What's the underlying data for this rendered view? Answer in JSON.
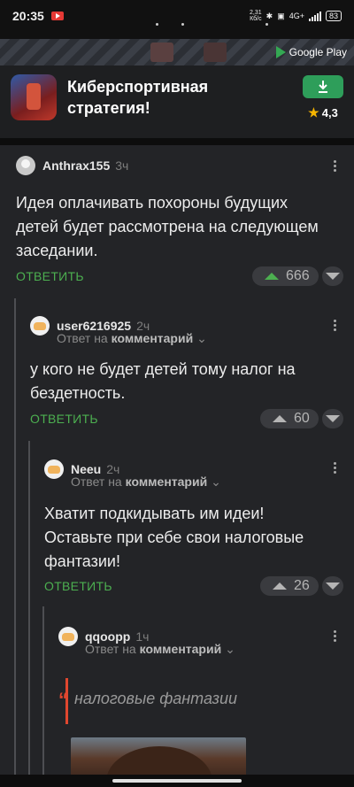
{
  "status_bar": {
    "time": "20:35",
    "speed_value": "2,31",
    "speed_unit": "Кб/с",
    "network": "4G+",
    "battery": "83"
  },
  "ad": {
    "store_label": "Google Play",
    "title": "Киберспортивная стратегия!",
    "rating": "4,3"
  },
  "comments": [
    {
      "username": "Anthrax155",
      "time": "3ч",
      "text": "Идея оплачивать похороны будущих детей будет рассмотрена на следующем заседании.",
      "reply_label": "ОТВЕТИТЬ",
      "votes": "666"
    },
    {
      "username": "user6216925",
      "time": "2ч",
      "reply_prefix": "Ответ на",
      "reply_target": "комментарий",
      "text": "у кого не будет детей тому налог на бездетность.",
      "reply_label": "ОТВЕТИТЬ",
      "votes": "60"
    },
    {
      "username": "Neeu",
      "time": "2ч",
      "reply_prefix": "Ответ на",
      "reply_target": "комментарий",
      "text": "Хватит подкидывать им идеи! Оставьте при себе свои налоговые фантазии!",
      "reply_label": "ОТВЕТИТЬ",
      "votes": "26"
    },
    {
      "username": "qqoopp",
      "time": "1ч",
      "reply_prefix": "Ответ на",
      "reply_target": "комментарий",
      "quote": "налоговые фантазии"
    }
  ]
}
